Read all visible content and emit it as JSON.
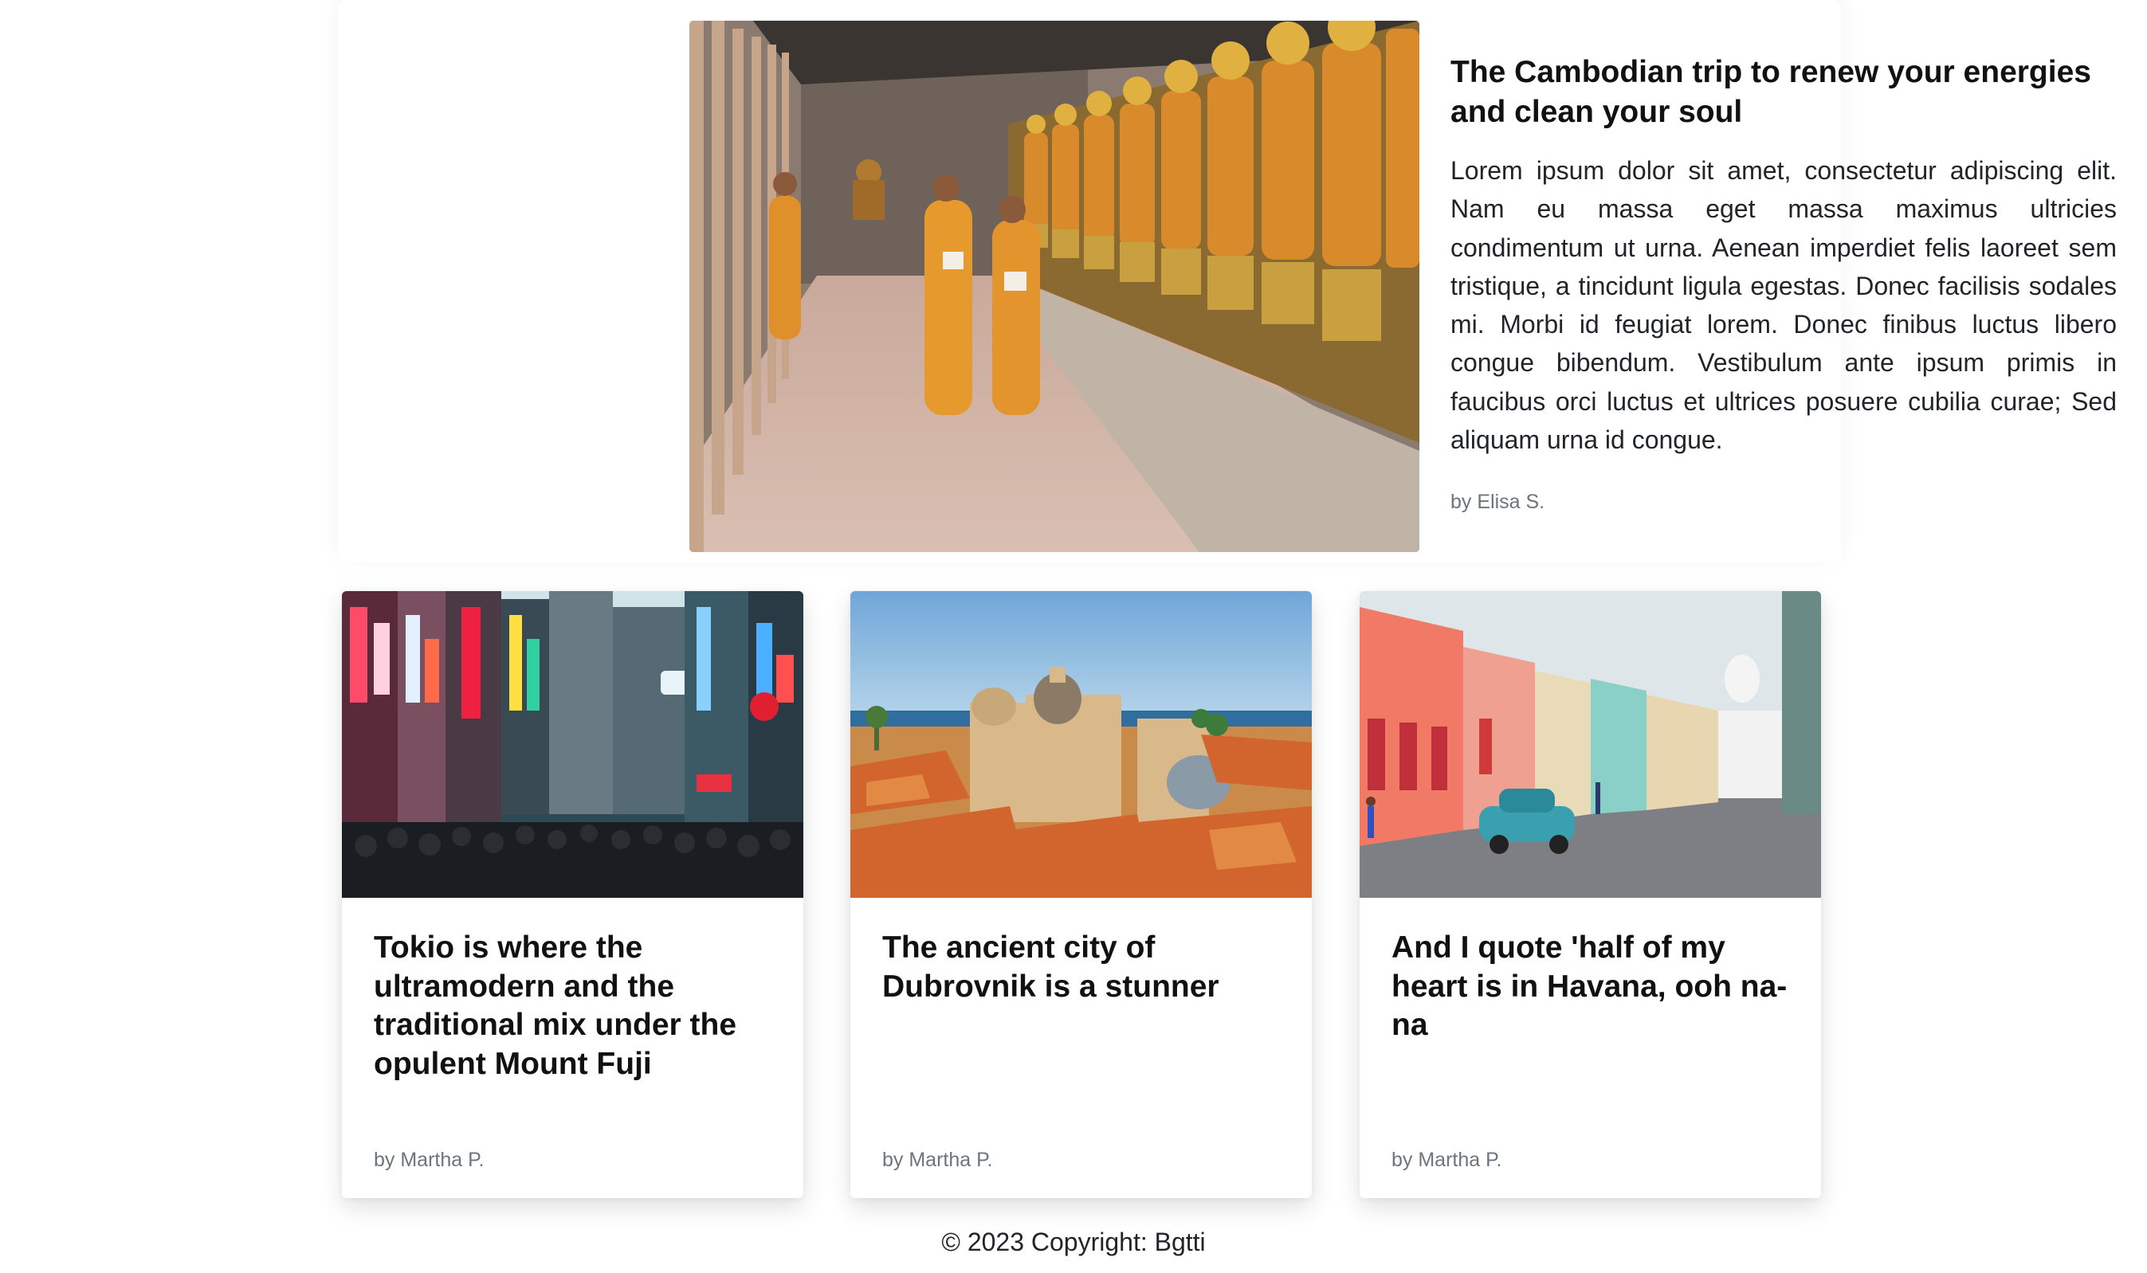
{
  "featured": {
    "title": "The Cambodian trip to renew your energies and clean your soul",
    "body": "Lorem ipsum dolor sit amet, consectetur adipiscing elit. Nam eu massa eget massa maximus ultricies condimentum ut urna. Aenean imperdiet felis laoreet sem tristique, a tincidunt ligula egestas. Donec facilisis sodales mi. Morbi id feugiat lorem. Donec finibus luctus libero congue bibendum. Vestibulum ante ipsum primis in faucibus orci luctus et ultrices posuere cubilia curae; Sed aliquam urna id congue.",
    "author": "by Elisa S."
  },
  "cards": [
    {
      "title": "Tokio is where the ultramodern and the traditional mix under the opulent Mount Fuji",
      "author": "by Martha P."
    },
    {
      "title": "The ancient city of Dubrovnik is a stunner",
      "author": "by Martha P."
    },
    {
      "title": "And I quote 'half of my heart is in Havana, ooh na-na",
      "author": "by Martha P."
    }
  ],
  "footer": {
    "copyright": "© 2023 Copyright: Bgtti"
  }
}
